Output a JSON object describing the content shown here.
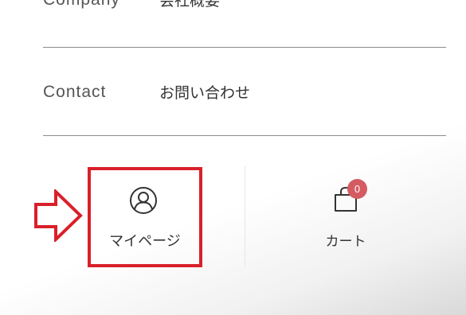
{
  "nav": {
    "company": {
      "en": "Company",
      "jp": "会社概要"
    },
    "contact": {
      "en": "Contact",
      "jp": "お問い合わせ"
    }
  },
  "footer": {
    "mypage": {
      "label": "マイページ",
      "icon": "user-circle-icon"
    },
    "cart": {
      "label": "カート",
      "icon": "shopping-bag-icon",
      "count": "0"
    }
  },
  "annotation": {
    "highlight_color": "#d9202a",
    "arrow": "right-arrow-icon"
  },
  "colors": {
    "badge": "#d45b61",
    "divider": "#8c8c8c"
  }
}
